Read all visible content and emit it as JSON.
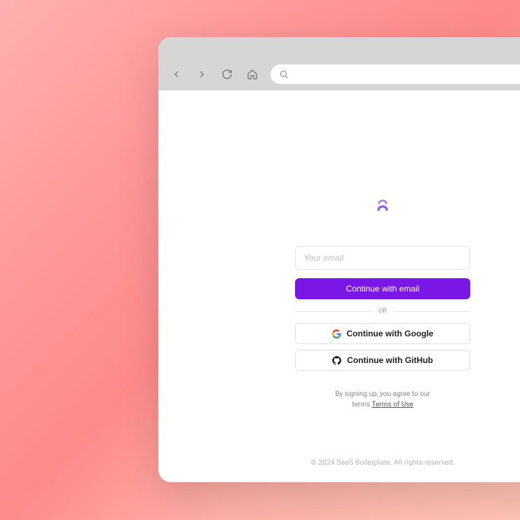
{
  "toolbar": {
    "back": "Back",
    "forward": "Forward",
    "refresh": "Refresh",
    "home": "Home",
    "search_placeholder": ""
  },
  "auth": {
    "email_placeholder": "Your email",
    "continue_email": "Continue with email",
    "or": "OR",
    "continue_google": "Continue with Google",
    "continue_github": "Continue with GitHub",
    "legal_prefix": "By signing up, you agree to our",
    "legal_terms_word": "terms",
    "terms_link": "Terms of Use"
  },
  "footer": "© 2024 SaaS Boilerplate. All rights reserved."
}
